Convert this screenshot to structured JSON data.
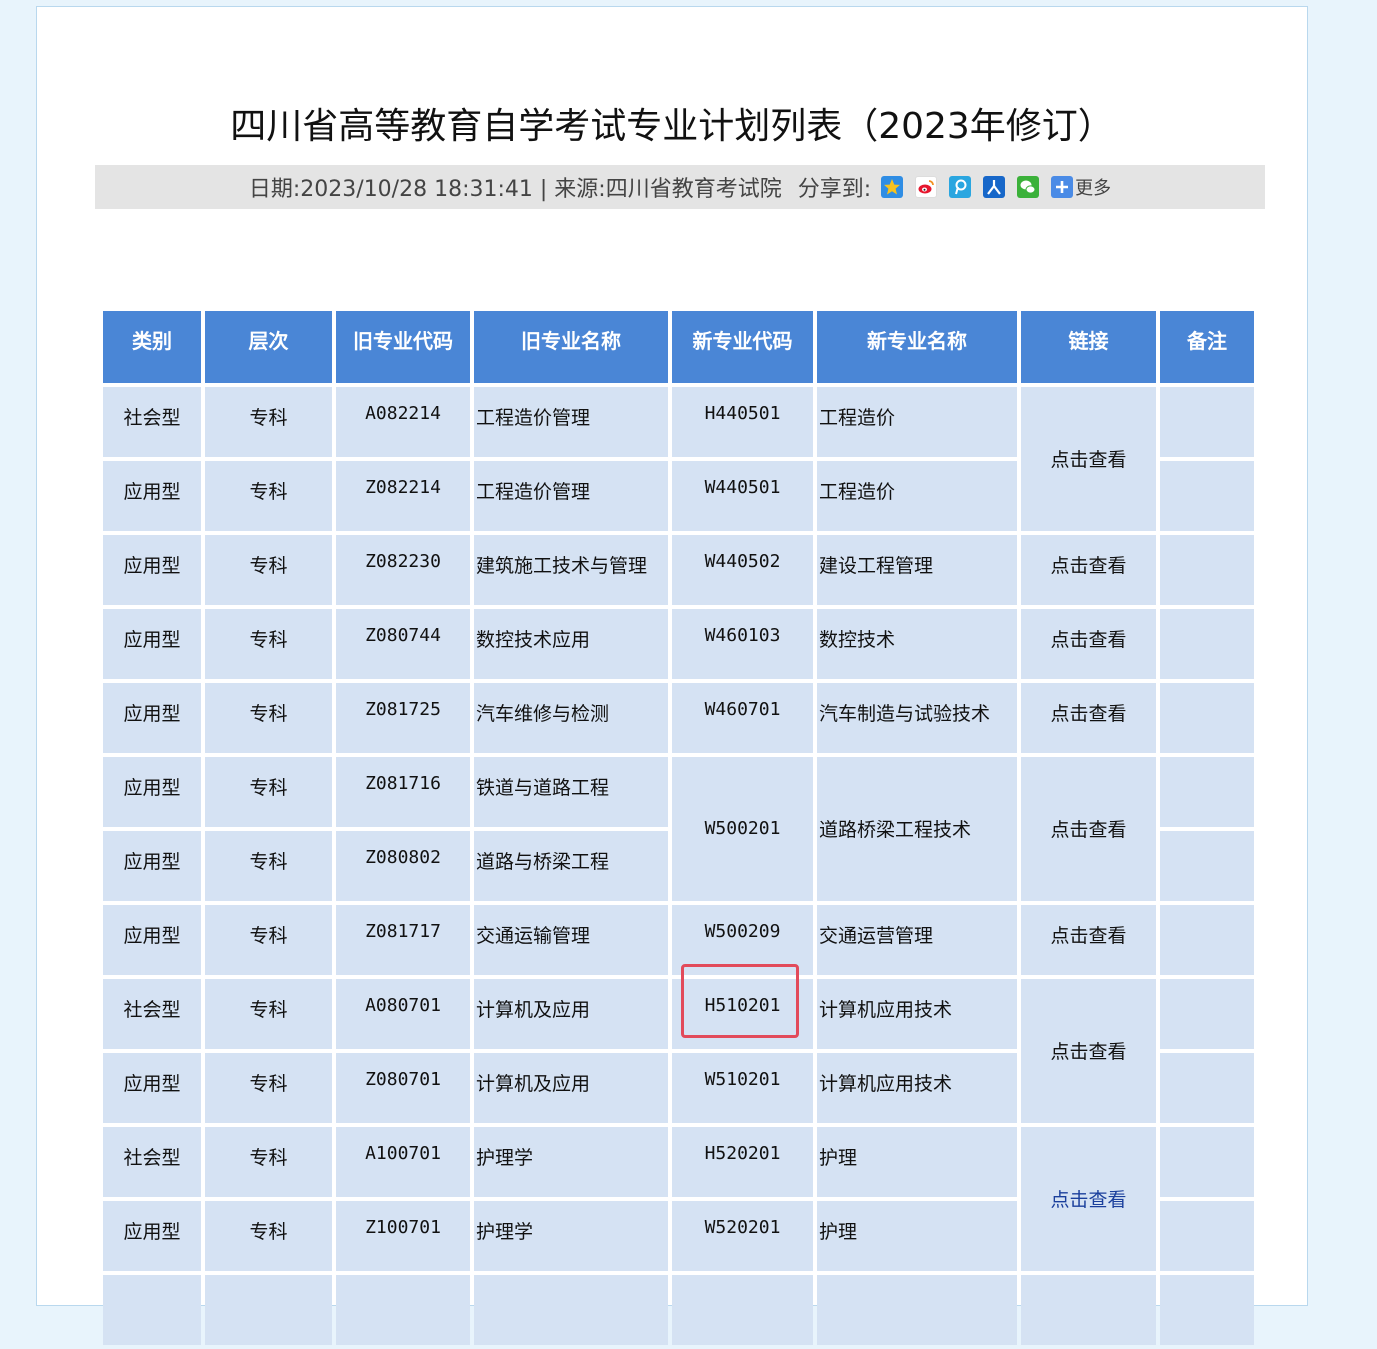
{
  "article": {
    "title": "四川省高等教育自学考试专业计划列表（2023年修订）",
    "meta_text": "日期:2023/10/28 18:31:41 | 来源:四川省教育考试院",
    "share_label": "分享到:",
    "share_more": "更多",
    "share_icons": [
      "qzone-icon",
      "weibo-icon",
      "tencent-weibo-icon",
      "renren-icon",
      "wechat-icon",
      "more-plus-icon"
    ]
  },
  "table": {
    "headers": [
      "类别",
      "层次",
      "旧专业代码",
      "旧专业名称",
      "新专业代码",
      "新专业名称",
      "链接",
      "备注"
    ],
    "rows": [
      {
        "category": "社会型",
        "level": "专科",
        "old_code": "A082214",
        "old_name": "工程造价管理",
        "new_code": "H440501",
        "new_name": "工程造价"
      },
      {
        "category": "应用型",
        "level": "专科",
        "old_code": "Z082214",
        "old_name": "工程造价管理",
        "new_code": "W440501",
        "new_name": "工程造价"
      },
      {
        "category": "应用型",
        "level": "专科",
        "old_code": "Z082230",
        "old_name": "建筑施工技术与管理",
        "new_code": "W440502",
        "new_name": "建设工程管理"
      },
      {
        "category": "应用型",
        "level": "专科",
        "old_code": "Z080744",
        "old_name": "数控技术应用",
        "new_code": "W460103",
        "new_name": "数控技术"
      },
      {
        "category": "应用型",
        "level": "专科",
        "old_code": "Z081725",
        "old_name": "汽车维修与检测",
        "new_code": "W460701",
        "new_name": "汽车制造与试验技术"
      },
      {
        "category": "应用型",
        "level": "专科",
        "old_code": "Z081716",
        "old_name": "铁道与道路工程",
        "new_code": "W500201",
        "new_name": "道路桥梁工程技术"
      },
      {
        "category": "应用型",
        "level": "专科",
        "old_code": "Z080802",
        "old_name": "道路与桥梁工程"
      },
      {
        "category": "应用型",
        "level": "专科",
        "old_code": "Z081717",
        "old_name": "交通运输管理",
        "new_code": "W500209",
        "new_name": "交通运营管理"
      },
      {
        "category": "社会型",
        "level": "专科",
        "old_code": "A080701",
        "old_name": "计算机及应用",
        "new_code": "H510201",
        "new_name": "计算机应用技术"
      },
      {
        "category": "应用型",
        "level": "专科",
        "old_code": "Z080701",
        "old_name": "计算机及应用",
        "new_code": "W510201",
        "new_name": "计算机应用技术"
      },
      {
        "category": "社会型",
        "level": "专科",
        "old_code": "A100701",
        "old_name": "护理学",
        "new_code": "H520201",
        "new_name": "护理"
      },
      {
        "category": "应用型",
        "level": "专科",
        "old_code": "Z100701",
        "old_name": "护理学",
        "new_code": "W520201",
        "new_name": "护理"
      }
    ],
    "link_text": "点击查看"
  },
  "colors": {
    "header_bg": "#4a86d6",
    "cell_bg": "#d5e2f3",
    "highlight_border": "#e24a5a",
    "visited_link": "#1a3f9c"
  }
}
